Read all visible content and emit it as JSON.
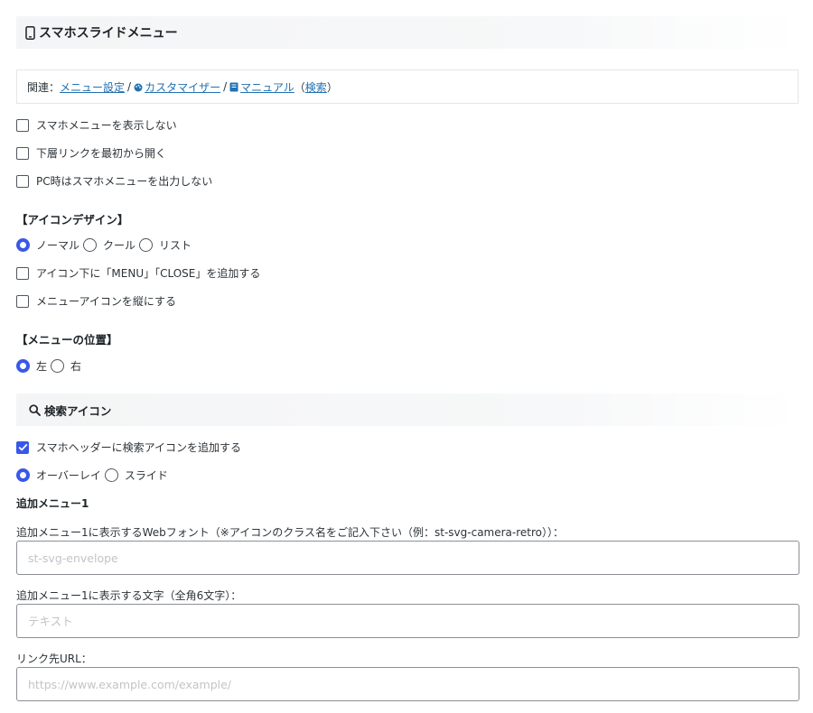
{
  "header": {
    "title": "スマホスライドメニュー"
  },
  "related": {
    "prefix": "関連：",
    "menu_settings": "メニュー設定",
    "customizer": "カスタマイザー",
    "manual": "マニュアル",
    "search_open": "（",
    "search": "検索",
    "search_close": "）",
    "sep": "/"
  },
  "options": {
    "hide_menu": "スマホメニューを表示しない",
    "open_sublinks": "下層リンクを最初から開く",
    "no_output_pc": "PC時はスマホメニューを出力しない"
  },
  "icon_design": {
    "title": "【アイコンデザイン】",
    "radios": [
      "ノーマル",
      "クール",
      "リスト"
    ],
    "selected": "ノーマル",
    "add_menu_close": "アイコン下に「MENU」「CLOSE」を追加する",
    "vertical_icon": "メニューアイコンを縦にする"
  },
  "menu_position": {
    "title": "【メニューの位置】",
    "radios": [
      "左",
      "右"
    ],
    "selected": "左"
  },
  "search_icon": {
    "title": "検索アイコン",
    "add_search_icon": "スマホヘッダーに検索アイコンを追加する",
    "add_search_icon_checked": true,
    "radios": [
      "オーバーレイ",
      "スライド"
    ],
    "selected": "オーバーレイ"
  },
  "additional_menu": {
    "title": "追加メニュー1",
    "webfont_label": "追加メニュー1に表示するWebフォント（※アイコンのクラス名をご記入下さい（例：st-svg-camera-retro））：",
    "webfont_placeholder": "st-svg-envelope",
    "text_label": "追加メニュー1に表示する文字（全角6文字）：",
    "text_placeholder": "テキスト",
    "url_label": "リンク先URL：",
    "url_placeholder": "https://www.example.com/example/"
  },
  "colors": {
    "accent": "#3858e9",
    "link": "#2271b1"
  },
  "icons": {
    "header": "smartphone-icon",
    "customizer": "palette-icon",
    "manual": "book-icon",
    "search": "search-icon"
  }
}
